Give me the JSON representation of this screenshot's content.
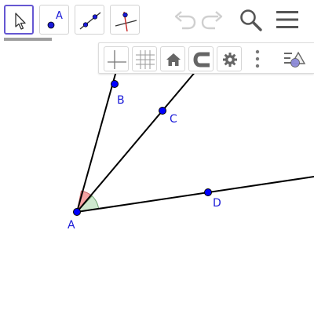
{
  "toolbar": {
    "tools": [
      {
        "name": "move-tool-button",
        "icon": "arrow-cursor-icon",
        "active": true
      },
      {
        "name": "point-tool-button",
        "icon": "point-icon",
        "label": "A"
      },
      {
        "name": "line-tool-button",
        "icon": "line-through-points-icon"
      },
      {
        "name": "perpendicular-line-tool-button",
        "icon": "perpendicular-line-icon"
      }
    ],
    "actions": [
      {
        "name": "undo-button",
        "icon": "undo-icon",
        "enabled": false
      },
      {
        "name": "redo-button",
        "icon": "redo-icon",
        "enabled": false
      },
      {
        "name": "search-button",
        "icon": "search-icon"
      },
      {
        "name": "main-menu-button",
        "icon": "hamburger-menu-icon"
      }
    ]
  },
  "style_bar": {
    "buttons": [
      {
        "name": "show-axes-button",
        "icon": "axes-icon"
      },
      {
        "name": "show-grid-button",
        "icon": "grid-icon"
      },
      {
        "name": "standard-view-button",
        "icon": "home-icon"
      },
      {
        "name": "point-capturing-button",
        "icon": "magnet-icon"
      },
      {
        "name": "graphics-settings-button",
        "icon": "gear-icon"
      },
      {
        "name": "more-options-button",
        "icon": "vertical-dots-icon"
      },
      {
        "name": "toggle-style-bar-button",
        "icon": "style-bar-triangle-icon"
      }
    ]
  },
  "graphics": {
    "points": [
      {
        "id": "A",
        "label": "A"
      },
      {
        "id": "B",
        "label": "B"
      },
      {
        "id": "C",
        "label": "C"
      },
      {
        "id": "D",
        "label": "D"
      }
    ],
    "colors": {
      "point_fill": "#0000ff",
      "point_stroke": "#000000",
      "label": "#1a1ad8",
      "line": "#000000",
      "angle_red": "#f4a3a3",
      "angle_green": "#cfe9cf"
    }
  }
}
